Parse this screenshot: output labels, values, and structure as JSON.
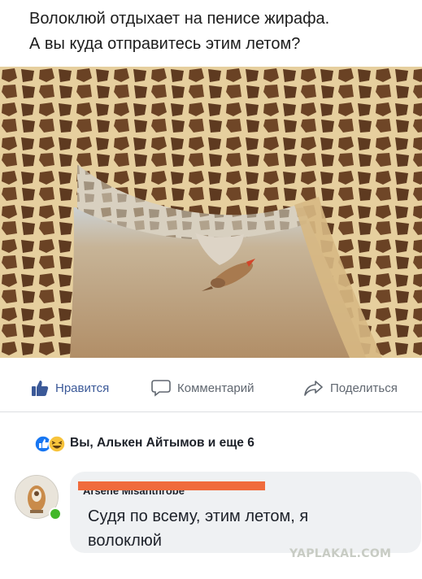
{
  "caption": {
    "line1": "Волоклюй отдыхает на пенисе жирафа.",
    "line2": "А вы куда отправитесь этим летом?"
  },
  "photo": {
    "description_icon": "giraffe-photo",
    "colors": {
      "sky": "#c9d7e3",
      "ground": "#b99a77",
      "spot": "#6a4224",
      "fur": "#e6cf9e"
    }
  },
  "actions": {
    "like_label": "Нравится",
    "comment_label": "Комментарий",
    "share_label": "Поделиться",
    "like_icon": "thumbs-up-icon",
    "comment_icon": "speech-bubble-icon",
    "share_icon": "share-arrow-icon",
    "colors": {
      "like": "#3b5998",
      "muted": "#606770"
    }
  },
  "reactions": {
    "summary": "Вы, Алькен Айтымов и еще 6",
    "icons": [
      "like-reaction-icon",
      "haha-reaction-icon"
    ]
  },
  "comment": {
    "author": "Arsene Misanthrope",
    "text_line1": "Судя по всему, этим летом, я",
    "text_line2": "волоклюй",
    "online": true,
    "colors": {
      "bubble": "#eff1f3",
      "redact": "#f06b3c",
      "online": "#42b72a"
    }
  },
  "watermark": "YAPLAKAL.COM"
}
